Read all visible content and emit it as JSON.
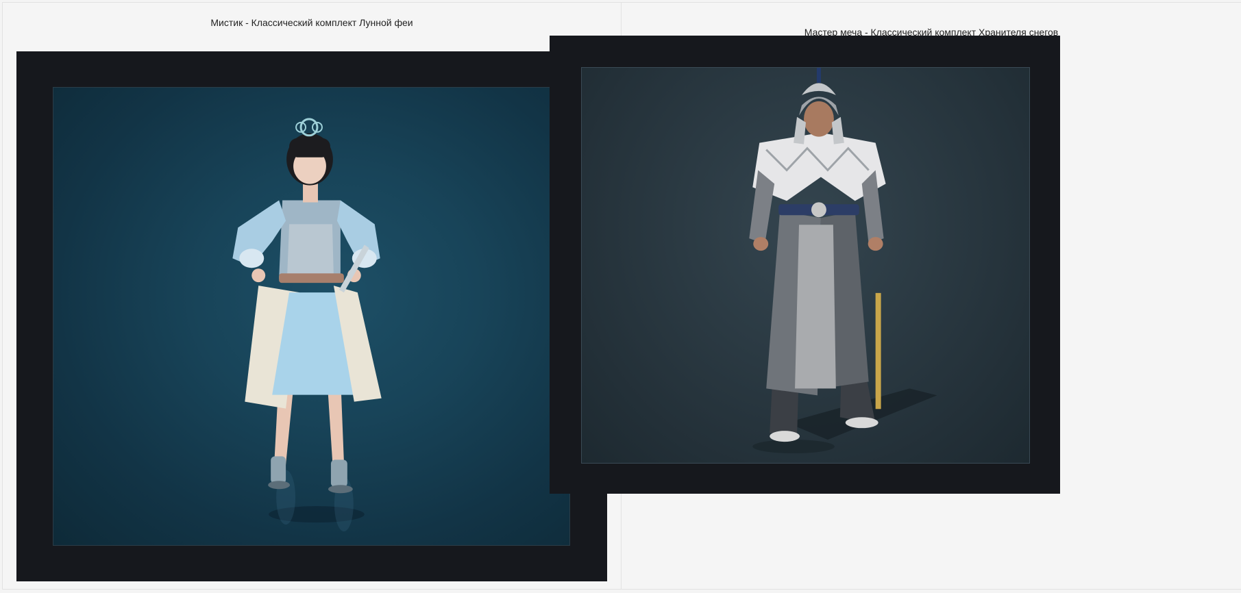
{
  "gallery": {
    "items": [
      {
        "caption": "Мистик - Классический комплект Лунной феи",
        "image_alt": "Мистик - Классический комплект Лунной феи",
        "background_color": "#184459"
      },
      {
        "caption": "Мастер меча - Классический комплект Хранителя снегов",
        "image_alt": "Мастер меча - Классический комплект Хранителя снегов",
        "background_color": "#2b3a43"
      }
    ]
  }
}
